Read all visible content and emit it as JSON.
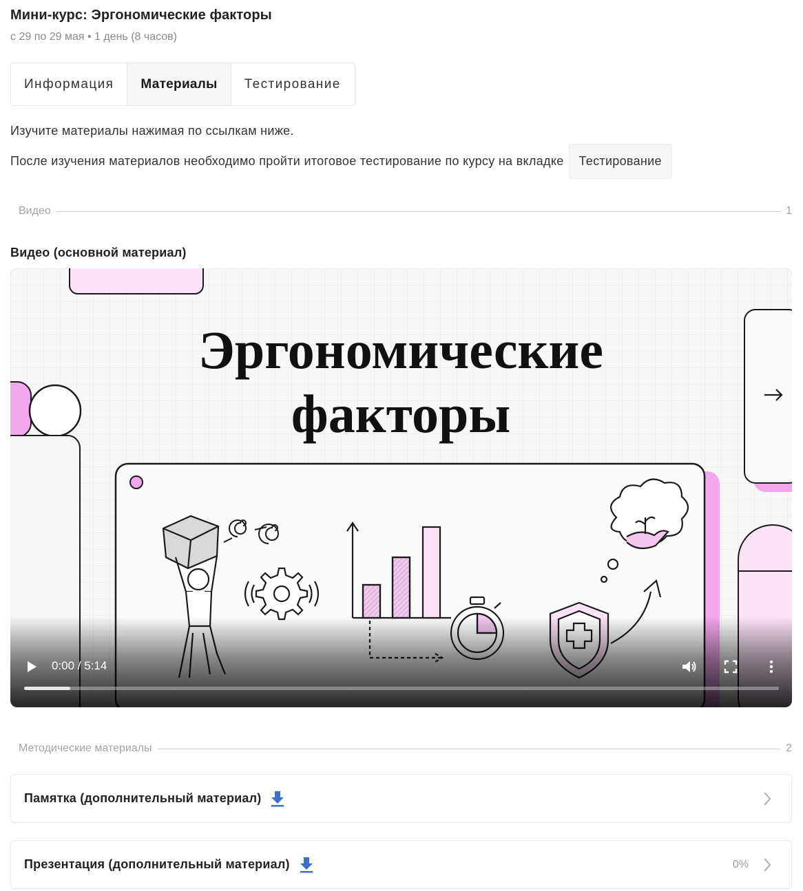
{
  "course": {
    "title": "Мини-курс: Эргономические факторы",
    "subtitle": "с 29 по 29 мая • 1 день (8 часов)"
  },
  "tabs": [
    {
      "label": "Информация",
      "active": false
    },
    {
      "label": "Материалы",
      "active": true
    },
    {
      "label": "Тестирование",
      "active": false
    }
  ],
  "intro": {
    "line1": "Изучите материалы нажимая по ссылкам ниже.",
    "line2": "После изучения материалов необходимо пройти итоговое тестирование по курсу на вкладке",
    "chip": "Тестирование"
  },
  "video_section": {
    "label": "Видео",
    "count": "1",
    "item_title": "Видео (основной материал)",
    "thumbnail_title_line1": "Эргономические",
    "thumbnail_title_line2": "факторы",
    "player": {
      "time": "0:00 / 5:14",
      "buffered_fraction": 0.061,
      "play_icon": "play-icon",
      "volume_icon": "volume-icon",
      "fullscreen_icon": "fullscreen-icon",
      "more_icon": "more-vert-icon"
    }
  },
  "methods_section": {
    "label": "Методические материалы",
    "count": "2",
    "items": [
      {
        "label": "Памятка (дополнительный материал)",
        "percent": "",
        "icon": "download-icon"
      },
      {
        "label": "Презентация (дополнительный материал)",
        "percent": "0%",
        "icon": "download-icon"
      }
    ]
  },
  "colors": {
    "accent_pink": "#f2a6ec",
    "light_pink": "#fbe3f7",
    "download_blue": "#3d6fc7",
    "muted_text": "#a3a3a3"
  }
}
